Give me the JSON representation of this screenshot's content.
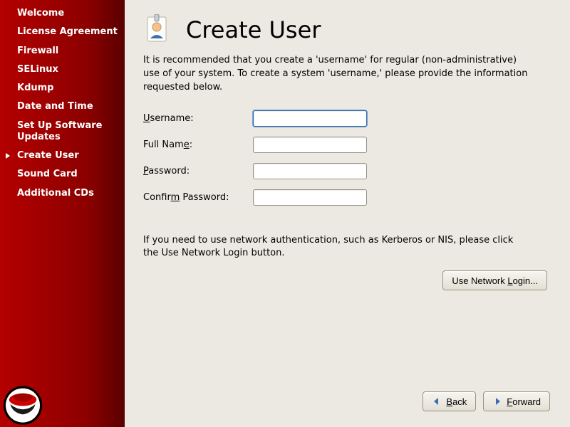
{
  "sidebar": {
    "items": [
      {
        "label": "Welcome",
        "active": false
      },
      {
        "label": "License Agreement",
        "active": false
      },
      {
        "label": "Firewall",
        "active": false
      },
      {
        "label": "SELinux",
        "active": false
      },
      {
        "label": "Kdump",
        "active": false
      },
      {
        "label": "Date and Time",
        "active": false
      },
      {
        "label": "Set Up Software Updates",
        "active": false
      },
      {
        "label": "Create User",
        "active": true
      },
      {
        "label": "Sound Card",
        "active": false
      },
      {
        "label": "Additional CDs",
        "active": false
      }
    ]
  },
  "page": {
    "title": "Create User",
    "intro": "It is recommended that you create a 'username' for regular (non-administrative) use of your system. To create a system 'username,' please provide the information requested below.",
    "form": {
      "username_label": "Username:",
      "username_value": "",
      "fullname_label": "Full Name:",
      "fullname_value": "",
      "password_label": "Password:",
      "password_value": "",
      "confirm_label": "Confirm Password:",
      "confirm_value": ""
    },
    "network_hint": "If you need to use network authentication, such as Kerberos or NIS, please click the Use Network Login button.",
    "network_button": "Use Network Login..."
  },
  "footer": {
    "back": "Back",
    "forward": "Forward"
  },
  "colors": {
    "sidebar_red": "#a00000",
    "panel_bg": "#ece9e2"
  }
}
